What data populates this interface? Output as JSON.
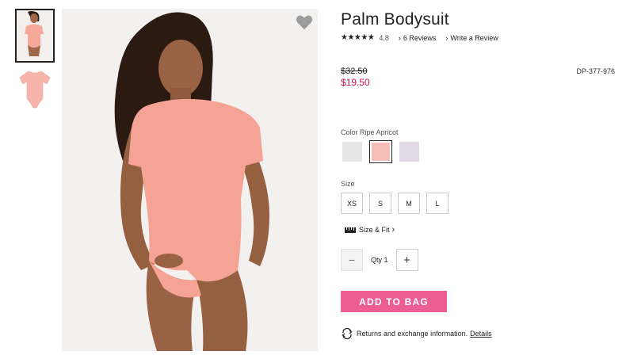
{
  "product": {
    "title": "Palm Bodysuit",
    "stars": "★★★★★",
    "rating": "4.8",
    "reviews_link": "6 Reviews",
    "write_review_link": "Write a Review",
    "original_price": "$32.50",
    "sale_price": "$19.50",
    "sku": "DP-377-976"
  },
  "color": {
    "label": "Color Ripe Apricot",
    "swatches": [
      {
        "name": "light-grey",
        "hex": "#e6e6e6"
      },
      {
        "name": "ripe-apricot",
        "hex": "#f7bdb8",
        "selected": true
      },
      {
        "name": "lavender",
        "hex": "#e3d8e6"
      }
    ]
  },
  "size": {
    "label": "Size",
    "options": [
      "XS",
      "S",
      "M",
      "L"
    ],
    "size_fit_link": "Size & Fit"
  },
  "quantity": {
    "minus": "−",
    "text": "Qty 1",
    "plus": "+"
  },
  "actions": {
    "add_to_bag": "ADD TO BAG"
  },
  "returns": {
    "text": "Returns and exchange information.",
    "details_link": "Details"
  },
  "icons": {
    "favorite": "heart-icon",
    "size_fit": "ruler-icon",
    "returns": "exchange-icon"
  },
  "colors": {
    "accent": "#ec5d94",
    "sale_price": "#c8104e",
    "product": "#f5a394"
  }
}
